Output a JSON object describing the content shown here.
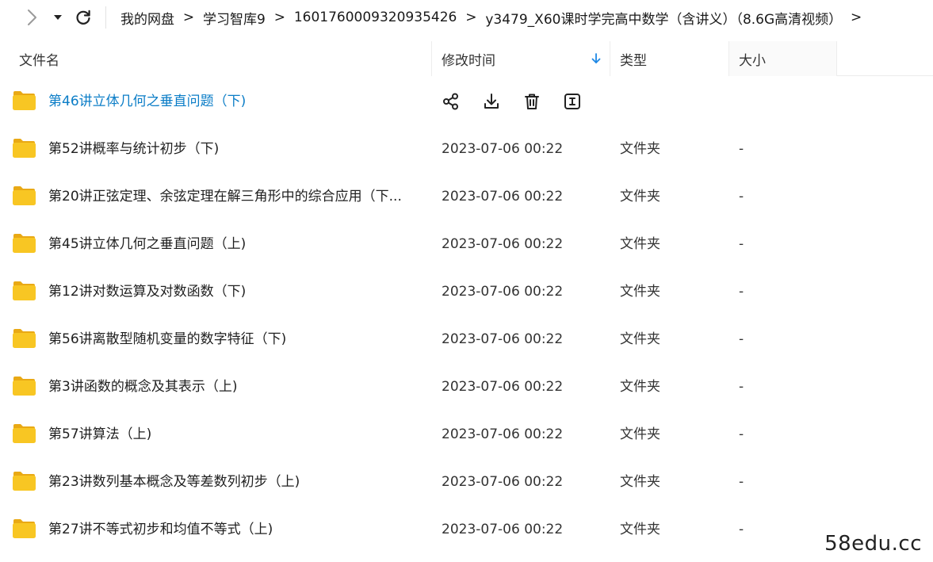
{
  "nav": {
    "forward_icon": "chevron-right-icon",
    "dropdown_icon": "caret-down-icon",
    "refresh_icon": "refresh-icon"
  },
  "breadcrumb": {
    "separator": ">",
    "items": [
      "我的网盘",
      "学习智库9",
      "1601760009320935426",
      "y3479_X60课时学完高中数学（含讲义）（8.6G高清视频）"
    ]
  },
  "columns": {
    "name": "文件名",
    "date": "修改时间",
    "type": "类型",
    "size": "大小",
    "sort_icon": "sort-arrow-down-icon"
  },
  "row_actions": {
    "share_icon": "share-icon",
    "download_icon": "download-icon",
    "delete_icon": "trash-icon",
    "rename_icon": "rename-icon"
  },
  "colors": {
    "active_text": "#0b7dc7",
    "folder_yellow": "#f7c325",
    "sort_arrow": "#1e88e5"
  },
  "files": [
    {
      "name": "第46讲立体几何之垂直问题（下)",
      "date": "",
      "type": "",
      "size": "",
      "active": true
    },
    {
      "name": "第52讲概率与统计初步（下)",
      "date": "2023-07-06 00:22",
      "type": "文件夹",
      "size": "-"
    },
    {
      "name": "第20讲正弦定理、余弦定理在解三角形中的综合应用（下...",
      "date": "2023-07-06 00:22",
      "type": "文件夹",
      "size": "-"
    },
    {
      "name": "第45讲立体几何之垂直问题（上)",
      "date": "2023-07-06 00:22",
      "type": "文件夹",
      "size": "-"
    },
    {
      "name": "第12讲对数运算及对数函数（下)",
      "date": "2023-07-06 00:22",
      "type": "文件夹",
      "size": "-"
    },
    {
      "name": "第56讲离散型随机变量的数字特征（下)",
      "date": "2023-07-06 00:22",
      "type": "文件夹",
      "size": "-"
    },
    {
      "name": "第3讲函数的概念及其表示（上)",
      "date": "2023-07-06 00:22",
      "type": "文件夹",
      "size": "-"
    },
    {
      "name": "第57讲算法（上)",
      "date": "2023-07-06 00:22",
      "type": "文件夹",
      "size": "-"
    },
    {
      "name": "第23讲数列基本概念及等差数列初步（上)",
      "date": "2023-07-06 00:22",
      "type": "文件夹",
      "size": "-"
    },
    {
      "name": "第27讲不等式初步和均值不等式（上)",
      "date": "2023-07-06 00:22",
      "type": "文件夹",
      "size": "-"
    }
  ],
  "watermark": "58edu.cc"
}
